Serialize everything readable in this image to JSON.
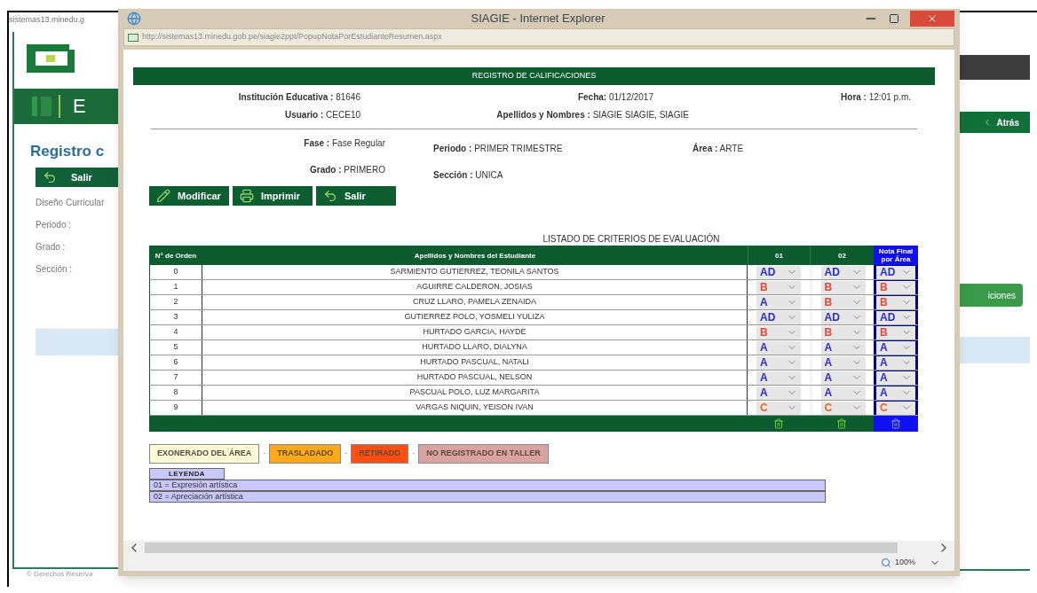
{
  "background": {
    "address": "sistemas13.minedu.g",
    "brand_letter": "E",
    "page_title": "Registro c",
    "exit_button": "Salir",
    "fields": [
      "Diseño Curricular",
      "Periodo :",
      "Grado :",
      "Sección :"
    ],
    "footer": "© Derechos Reserva",
    "back_button": "Atrás",
    "right_button": "iciones"
  },
  "popup": {
    "title": "SIAGIE - Internet Explorer",
    "url": "http://sistemas13.minedu.gob.pe/siagie2ppt/PopupNotaPorEstudianteResumen.aspx",
    "header": "REGISTRO DE CALIFICACIONES",
    "info_rows": [
      [
        {
          "label": "Institución Educativa :",
          "value": "81646"
        },
        {
          "label": "Fecha:",
          "value": "01/12/2017"
        },
        {
          "label": "Hora :",
          "value": "12:01 p.m."
        }
      ],
      [
        {
          "label": "Usuario :",
          "value": "CECE10"
        },
        {
          "label": "Apellidos y Nombres :",
          "value": "SIAGIE SIAGIE, SIAGIE"
        }
      ]
    ],
    "detail_rows": [
      [
        {
          "label": "Fase :",
          "value": "Fase Regular"
        },
        {
          "label": "Periodo :",
          "value": "PRIMER TRIMESTRE"
        },
        {
          "label": "Área :",
          "value": "ARTE"
        }
      ],
      [
        {
          "label": "Grado :",
          "value": "PRIMERO"
        },
        {
          "label": "Sección :",
          "value": "UNICA"
        }
      ]
    ],
    "buttons": [
      {
        "kind": "edit",
        "label": "Modificar"
      },
      {
        "kind": "print",
        "label": "Imprimir"
      },
      {
        "kind": "exit",
        "label": "Salir"
      }
    ],
    "table_caption": "LISTADO DE CRITERIOS DE EVALUACIÓN",
    "columns": [
      "N° de Orden",
      "Apellidos y Nombres del Estudiante",
      "01",
      "02",
      "Nota Final por Área"
    ],
    "rows": [
      {
        "order": "0",
        "name": "SARMIENTO GUTIERREZ, TEONILA SANTOS",
        "grades": [
          {
            "value": "AD",
            "color": "#2b2bd6"
          },
          {
            "value": "AD",
            "color": "#2b2bd6"
          },
          {
            "value": "AD",
            "color": "#2b2bd6"
          }
        ]
      },
      {
        "order": "1",
        "name": "AGUIRRE CALDERON, JOSIAS",
        "grades": [
          {
            "value": "B",
            "color": "#e8463a"
          },
          {
            "value": "B",
            "color": "#e8463a"
          },
          {
            "value": "B",
            "color": "#e8463a"
          }
        ]
      },
      {
        "order": "2",
        "name": "CRUZ LLARO, PAMELA ZENAIDA",
        "grades": [
          {
            "value": "A",
            "color": "#2b2bd6"
          },
          {
            "value": "B",
            "color": "#e8463a"
          },
          {
            "value": "B",
            "color": "#e8463a"
          }
        ]
      },
      {
        "order": "3",
        "name": "GUTIERREZ POLO, YOSMELI YULIZA",
        "grades": [
          {
            "value": "AD",
            "color": "#2b2bd6"
          },
          {
            "value": "AD",
            "color": "#2b2bd6"
          },
          {
            "value": "AD",
            "color": "#2b2bd6"
          }
        ]
      },
      {
        "order": "4",
        "name": "HURTADO GARCIA, HAYDE",
        "grades": [
          {
            "value": "B",
            "color": "#e8463a"
          },
          {
            "value": "B",
            "color": "#e8463a"
          },
          {
            "value": "B",
            "color": "#e8463a"
          }
        ]
      },
      {
        "order": "5",
        "name": "HURTADO LLARO, DIALYNA",
        "grades": [
          {
            "value": "A",
            "color": "#2b2bd6"
          },
          {
            "value": "A",
            "color": "#2b2bd6"
          },
          {
            "value": "A",
            "color": "#2b2bd6"
          }
        ]
      },
      {
        "order": "6",
        "name": "HURTADO PASCUAL, NATALI",
        "grades": [
          {
            "value": "A",
            "color": "#2b2bd6"
          },
          {
            "value": "A",
            "color": "#2b2bd6"
          },
          {
            "value": "A",
            "color": "#2b2bd6"
          }
        ]
      },
      {
        "order": "7",
        "name": "HURTADO PASCUAL, NELSON",
        "grades": [
          {
            "value": "A",
            "color": "#2b2bd6"
          },
          {
            "value": "A",
            "color": "#2b2bd6"
          },
          {
            "value": "A",
            "color": "#2b2bd6"
          }
        ]
      },
      {
        "order": "8",
        "name": "PASCUAL POLO, LUZ MARGARITA",
        "grades": [
          {
            "value": "A",
            "color": "#2b2bd6"
          },
          {
            "value": "A",
            "color": "#2b2bd6"
          },
          {
            "value": "A",
            "color": "#2b2bd6"
          }
        ]
      },
      {
        "order": "9",
        "name": "VARGAS NIQUIN, YEISON IVAN",
        "grades": [
          {
            "value": "C",
            "color": "#f0602a"
          },
          {
            "value": "C",
            "color": "#f0602a"
          },
          {
            "value": "C",
            "color": "#f0602a"
          }
        ]
      }
    ],
    "status_chips": [
      {
        "label": "EXONERADO DEL ÁREA",
        "color": "#fdfbd8"
      },
      {
        "label": "TRASLADADO",
        "color": "#ffa81a"
      },
      {
        "label": "RETIRADO",
        "color": "#ff4f12"
      },
      {
        "label": "NO REGISTRADO EN TALLER",
        "color": "#d9a3a3"
      }
    ],
    "chip_separator": "-",
    "legend_title": "LEYENDA",
    "legend_items": [
      "01 = Expresión artística",
      "02 = Apreciación artística"
    ],
    "zoom": "100%"
  }
}
